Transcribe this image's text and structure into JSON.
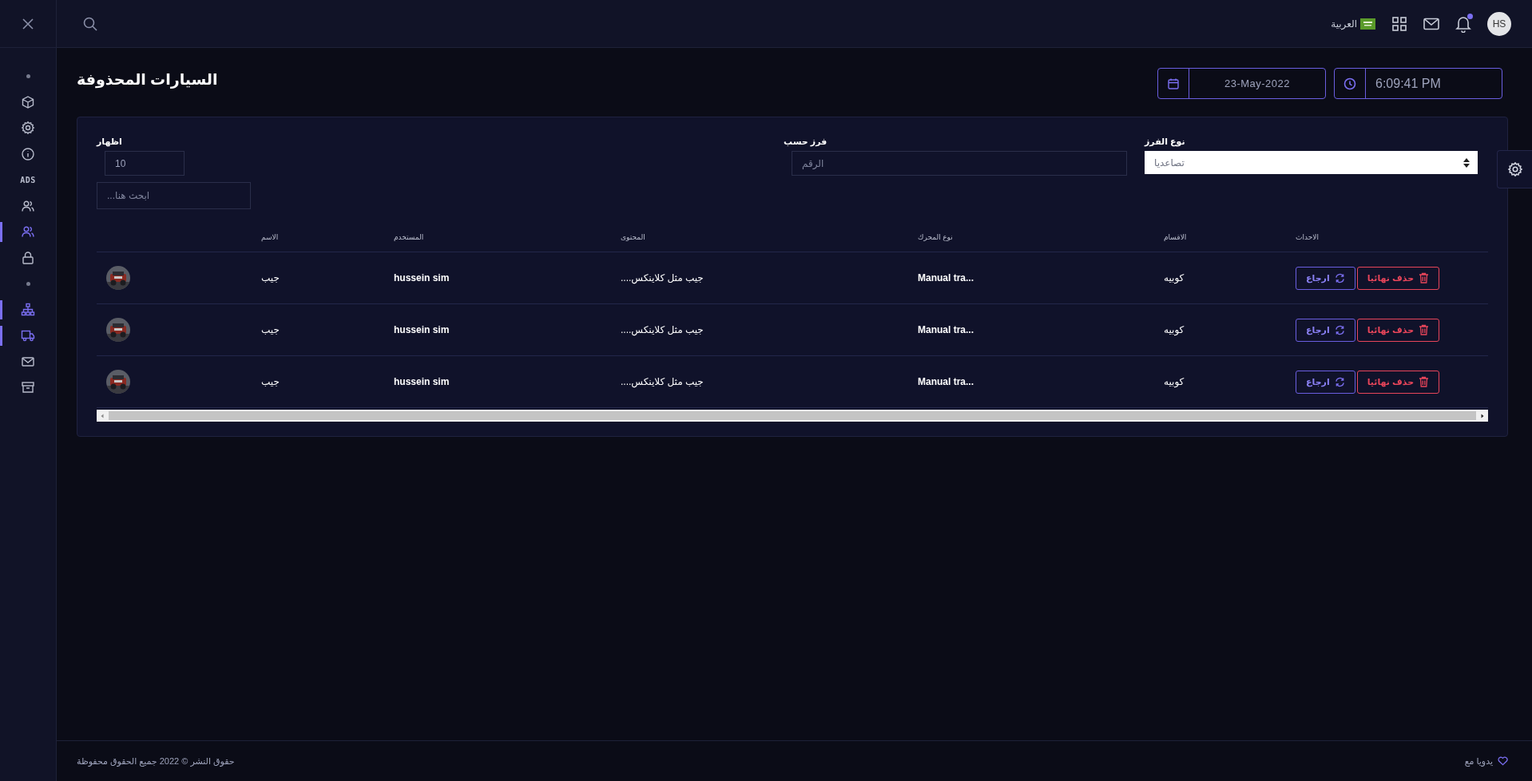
{
  "topbar": {
    "language": "العربية",
    "avatar": "HS",
    "notification_badge": true
  },
  "sidebar": {
    "items": [
      {
        "kind": "dot"
      },
      {
        "kind": "icon",
        "selected": false
      },
      {
        "kind": "icon",
        "selected": false
      },
      {
        "kind": "icon",
        "selected": false
      },
      {
        "kind": "label",
        "text": "ADS"
      },
      {
        "kind": "icon",
        "selected": false
      },
      {
        "kind": "icon",
        "selected": true
      },
      {
        "kind": "icon",
        "selected": false
      },
      {
        "kind": "dot"
      },
      {
        "kind": "icon",
        "selected": true
      },
      {
        "kind": "icon",
        "selected": true
      },
      {
        "kind": "icon",
        "selected": false
      },
      {
        "kind": "icon",
        "selected": false
      }
    ]
  },
  "page": {
    "title": "السيارات المحذوفة",
    "date": "23-May-2022",
    "time": "6:09:41 PM"
  },
  "filters": {
    "show": {
      "label": "اظهار",
      "value": "10"
    },
    "search": {
      "placeholder": "...ابحث هنا"
    },
    "sort_by": {
      "label": "فرز حسب",
      "placeholder": "الرقم"
    },
    "sort_type": {
      "label": "نوع الفرز",
      "value": "تصاعديا"
    }
  },
  "table": {
    "columns": [
      "الاحداث",
      "الاقسام",
      "نوع المحرك",
      "المحتوى",
      "المستخدم",
      "الاسم"
    ],
    "rows": [
      {
        "name": "جيب",
        "user": "hussein sim",
        "content": "....جيب مثل كلاينكس",
        "engine": "Manual tra...",
        "section": "كوبيه",
        "actions": [
          {
            "kind": "delete",
            "label": "حذف نهائيا"
          },
          {
            "kind": "restore",
            "label": "ارجاع"
          }
        ]
      },
      {
        "name": "جيب",
        "user": "hussein sim",
        "content": "....جيب مثل كلاينكس",
        "engine": "Manual tra...",
        "section": "كوبيه",
        "actions": [
          {
            "kind": "delete",
            "label": "حذف نهائيا"
          },
          {
            "kind": "restore",
            "label": "ارجاع"
          }
        ]
      },
      {
        "name": "جيب",
        "user": "hussein sim",
        "content": "....جيب مثل كلاينكس",
        "engine": "Manual tra...",
        "section": "كوبيه",
        "actions": [
          {
            "kind": "delete",
            "label": "حذف نهائيا"
          },
          {
            "kind": "restore",
            "label": "ارجاع"
          }
        ]
      }
    ]
  },
  "footer": {
    "copyright": "حقوق النشر © 2022 جميع الحقوق محفوظة",
    "credit": "يدويا مع"
  }
}
